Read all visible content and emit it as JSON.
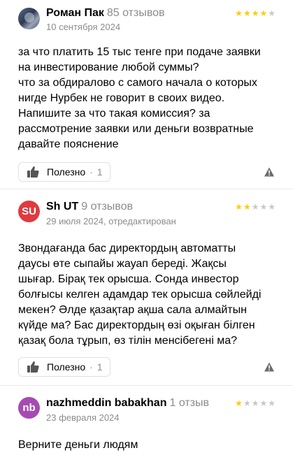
{
  "reviews": [
    {
      "avatar": {
        "initials": "",
        "color": "#3b4662"
      },
      "author": "Роман Пак",
      "reviews_count": "85 отзывов",
      "date": "10 сентября 2024",
      "rating": 4,
      "text": [
        "за что платить 15 тыс тенге при подаче заявки",
        "на инвестирование любой суммы?",
        "что за обдиралово с самого начала о которых",
        "нигде Нурбек не говорит в своих видео.",
        "Напишите за что такая комиссия? за",
        "рассмотрение заявки или деньги возвратные",
        "давайте пояснение"
      ],
      "like_label": "Полезно",
      "like_count": "1"
    },
    {
      "avatar": {
        "initials": "SU",
        "color": "#e03a3f"
      },
      "author": "Sh UT",
      "reviews_count": "9 отзывов",
      "date": "29 июля 2024, отредактирован",
      "rating": 2,
      "text": [
        "Звондағанда бас директордың автоматты",
        "даусы өте сыпайы жауап береді. Жақсы",
        "шығар. Бірақ тек орысша. Сонда инвестор",
        "болғысы келген адамдар тек орысша сөйлейді",
        "мекен? Әлде қазақтар ақша сала алмайтын",
        "күйде ма? Бас директордың өзі оқыған білген",
        "қазақ бола тұрып, өз тілін менсібегені ма?"
      ],
      "like_label": "Полезно",
      "like_count": "1"
    },
    {
      "avatar": {
        "initials": "nb",
        "color": "#a64ab4"
      },
      "author": "nazhmeddin babakhan",
      "reviews_count": "1 отзыв",
      "date": "23 февраля 2024",
      "rating": 1,
      "text": [
        "Верните деньги людям"
      ]
    }
  ],
  "icons": {
    "like": "thumbs-up-icon",
    "report": "warning-triangle-icon",
    "star": "star-icon"
  },
  "colors": {
    "star_on": "#ffcc00",
    "star_off": "#c8c8c8",
    "muted_text": "#8c8c8c"
  }
}
